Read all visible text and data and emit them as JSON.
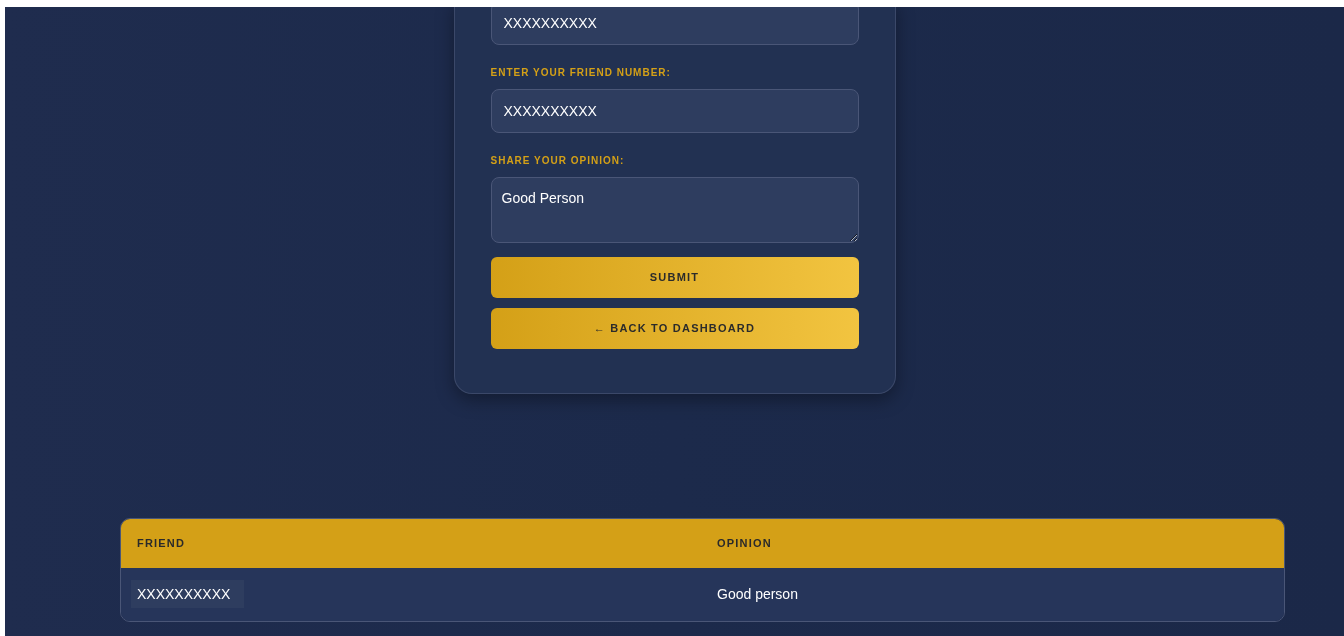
{
  "form": {
    "fields": [
      {
        "kind": "input",
        "value": "XXXXXXXXXX"
      },
      {
        "kind": "input",
        "label": "ENTER YOUR FRIEND NUMBER:",
        "value": "XXXXXXXXXX"
      },
      {
        "kind": "textarea",
        "label": "SHARE YOUR OPINION:",
        "value": "Good Person"
      }
    ],
    "buttons": [
      "SUBMIT",
      "← BACK TO DASHBOARD"
    ]
  },
  "table": {
    "columns": [
      "FRIEND",
      "OPINION"
    ],
    "rows": [
      [
        "XXXXXXXXXX",
        "Good person"
      ]
    ]
  }
}
